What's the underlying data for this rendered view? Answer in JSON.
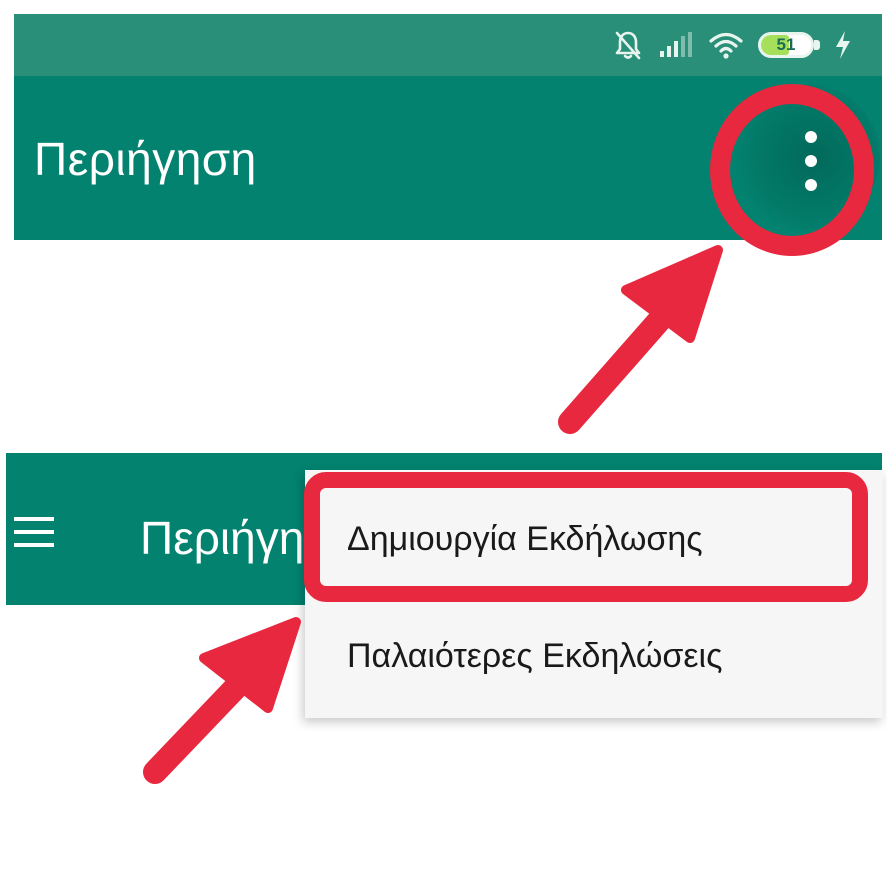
{
  "status_bar": {
    "battery_level": "51",
    "icons": [
      "bell-muted-icon",
      "signal-icon",
      "wifi-icon",
      "battery-icon",
      "charging-icon"
    ]
  },
  "top_screen": {
    "title": "Περιήγηση",
    "overflow_icon": "more-vert-icon"
  },
  "bottom_screen": {
    "title": "Περιήγηση",
    "nav_icon": "hamburger-menu-icon",
    "overflow_menu": {
      "items": [
        {
          "label": "Δημιουργία Εκδήλωσης",
          "highlighted": true
        },
        {
          "label": "Παλαιότερες Εκδηλώσεις",
          "highlighted": false
        }
      ]
    }
  },
  "colors": {
    "appbar": "#038270",
    "status_bar": "#2a8f78",
    "annotation": "#e8283e",
    "menu_background": "#f6f6f6"
  }
}
